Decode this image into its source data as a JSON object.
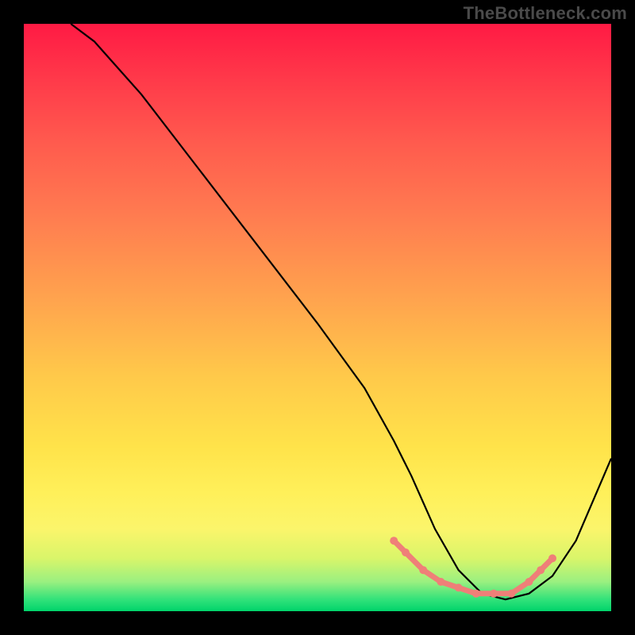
{
  "watermark": "TheBottleneck.com",
  "chart_data": {
    "type": "line",
    "title": "",
    "xlabel": "",
    "ylabel": "",
    "xlim": [
      0,
      100
    ],
    "ylim": [
      0,
      100
    ],
    "grid": false,
    "legend": false,
    "series": [
      {
        "name": "curve",
        "x": [
          8,
          12,
          20,
          30,
          40,
          50,
          58,
          63,
          66,
          70,
          74,
          78,
          82,
          86,
          90,
          94,
          100
        ],
        "y": [
          100,
          97,
          88,
          75,
          62,
          49,
          38,
          29,
          23,
          14,
          7,
          3,
          2,
          3,
          6,
          12,
          26
        ]
      }
    ],
    "markers": {
      "name": "highlight-dots",
      "color": "#ef7f78",
      "x": [
        63,
        65,
        68,
        71,
        74,
        77,
        80,
        83,
        86,
        88,
        90
      ],
      "y": [
        12,
        10,
        7,
        5,
        4,
        3,
        3,
        3,
        5,
        7,
        9
      ]
    },
    "annotations": []
  }
}
